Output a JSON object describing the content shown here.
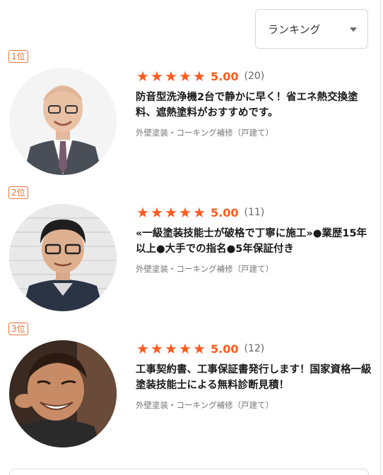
{
  "sort": {
    "selected": "ランキング",
    "icon": "caret-down-icon"
  },
  "accent_color": "#ff5a1f",
  "badge_color": "#e8733a",
  "items": [
    {
      "rank": "1位",
      "rating": "5.00",
      "stars": 5,
      "count": "(20)",
      "title": "防音型洗浄機2台で静かに早く！省エネ熱交換塗料、遮熱塗料がおすすめです。",
      "category": "外壁塗装・コーキング補修（戸建て）"
    },
    {
      "rank": "2位",
      "rating": "5.00",
      "stars": 5,
      "count": "(11)",
      "title": "«一級塗装技能士が破格で丁寧に施工»●業歴15年以上●大手での指名●5年保証付き",
      "category": "外壁塗装・コーキング補修（戸建て）"
    },
    {
      "rank": "3位",
      "rating": "5.00",
      "stars": 5,
      "count": "(12)",
      "title": "工事契約書、工事保証書発行します！国家資格一級塗装技能士による無料診断見積！",
      "category": "外壁塗装・コーキング補修（戸建て）"
    }
  ]
}
